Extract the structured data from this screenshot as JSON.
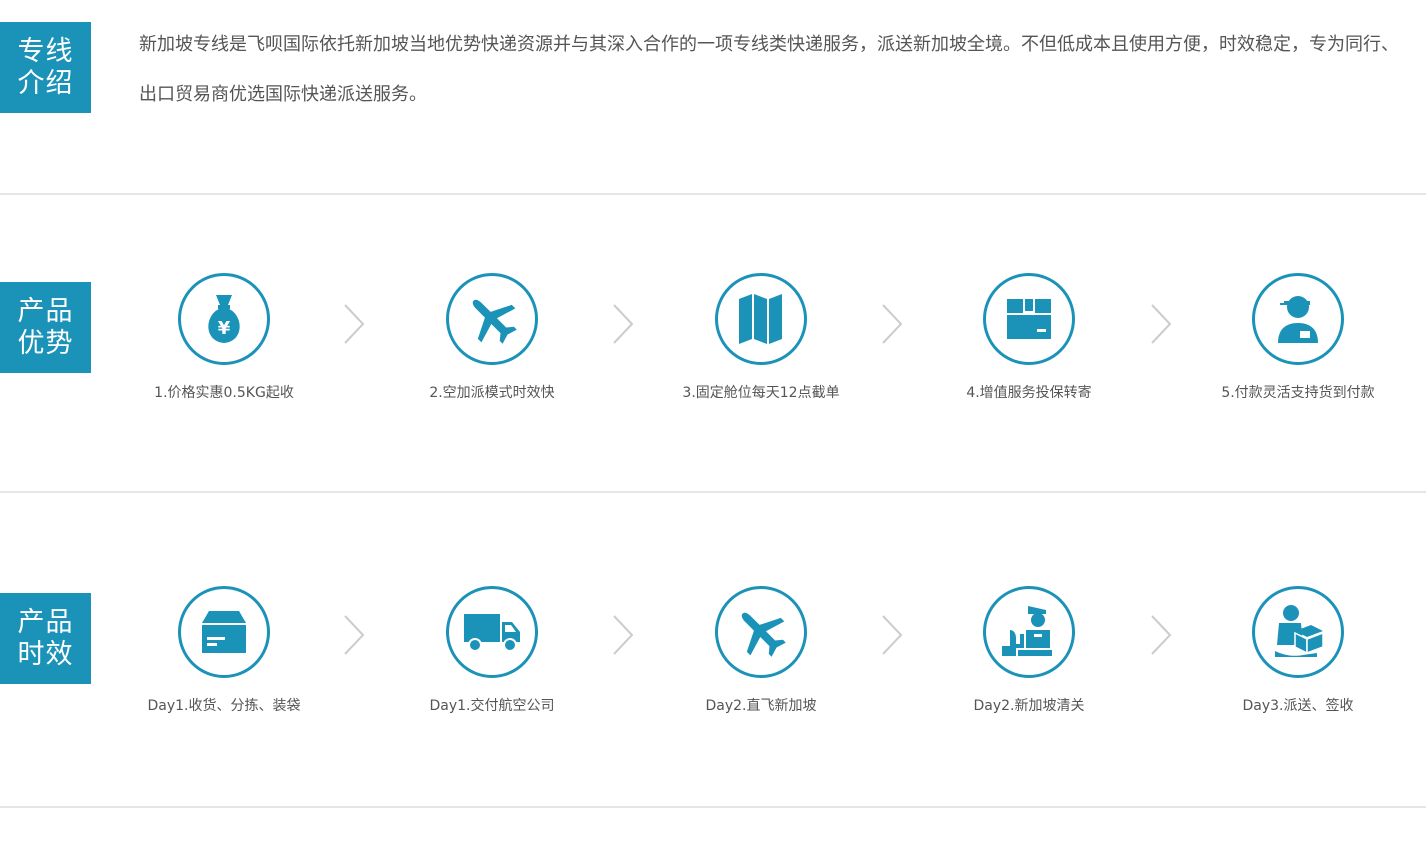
{
  "intro": {
    "label_line1": "专线",
    "label_line2": "介绍",
    "text": "新加坡专线是飞呗国际依托新加坡当地优势快递资源并与其深入合作的一项专线类快递服务，派送新加坡全境。不但低成本且使用方便，时效稳定，专为同行、出口贸易商优选国际快递派送服务。"
  },
  "advantages": {
    "label_line1": "产品",
    "label_line2": "优势",
    "items": [
      {
        "label": "1.价格实惠0.5KG起收",
        "icon": "money-bag-icon"
      },
      {
        "label": "2.空加派模式时效快",
        "icon": "airplane-icon"
      },
      {
        "label": "3.固定舱位每天12点截单",
        "icon": "map-icon"
      },
      {
        "label": "4.增值服务投保转寄",
        "icon": "package-icon"
      },
      {
        "label": "5.付款灵活支持货到付款",
        "icon": "courier-icon"
      }
    ]
  },
  "timeline": {
    "label_line1": "产品",
    "label_line2": "时效",
    "items": [
      {
        "label": "Day1.收货、分拣、装袋",
        "icon": "box-icon"
      },
      {
        "label": "Day1.交付航空公司",
        "icon": "truck-icon"
      },
      {
        "label": "Day2.直飞新加坡",
        "icon": "airplane-icon"
      },
      {
        "label": "Day2.新加坡清关",
        "icon": "customs-officer-icon"
      },
      {
        "label": "Day3.派送、签收",
        "icon": "delivery-person-icon"
      }
    ]
  },
  "colors": {
    "accent": "#1b92b8",
    "text": "#555555",
    "divider": "#e6e6e6",
    "arrow": "#cccccc"
  }
}
